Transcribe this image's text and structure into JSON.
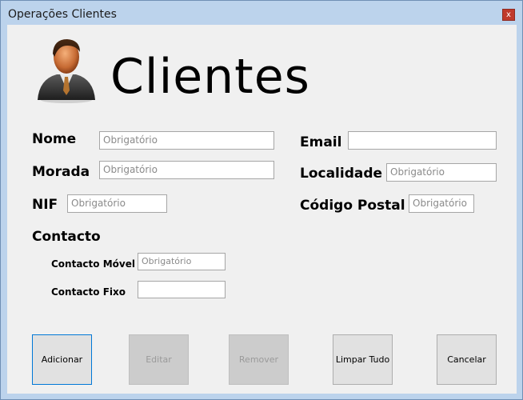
{
  "window": {
    "title": "Operações Clientes",
    "close_label": "x"
  },
  "header": {
    "title": "Clientes",
    "icon": "user-business-icon"
  },
  "form": {
    "nome": {
      "label": "Nome",
      "placeholder": "Obrigatório"
    },
    "morada": {
      "label": "Morada",
      "placeholder": "Obrigatório"
    },
    "nif": {
      "label": "NIF",
      "placeholder": "Obrigatório"
    },
    "email": {
      "label": "Email",
      "placeholder": ""
    },
    "localidade": {
      "label": "Localidade",
      "placeholder": "Obrigatório"
    },
    "codigo_postal": {
      "label": "Código Postal",
      "placeholder": "Obrigatório"
    },
    "contacto_heading": "Contacto",
    "contacto_movel": {
      "label": "Contacto Móvel",
      "placeholder": "Obrigatório"
    },
    "contacto_fixo": {
      "label": "Contacto Fixo",
      "placeholder": ""
    }
  },
  "buttons": {
    "adicionar": "Adicionar",
    "editar": "Editar",
    "remover": "Remover",
    "limpar": "Limpar Tudo",
    "cancelar": "Cancelar"
  }
}
